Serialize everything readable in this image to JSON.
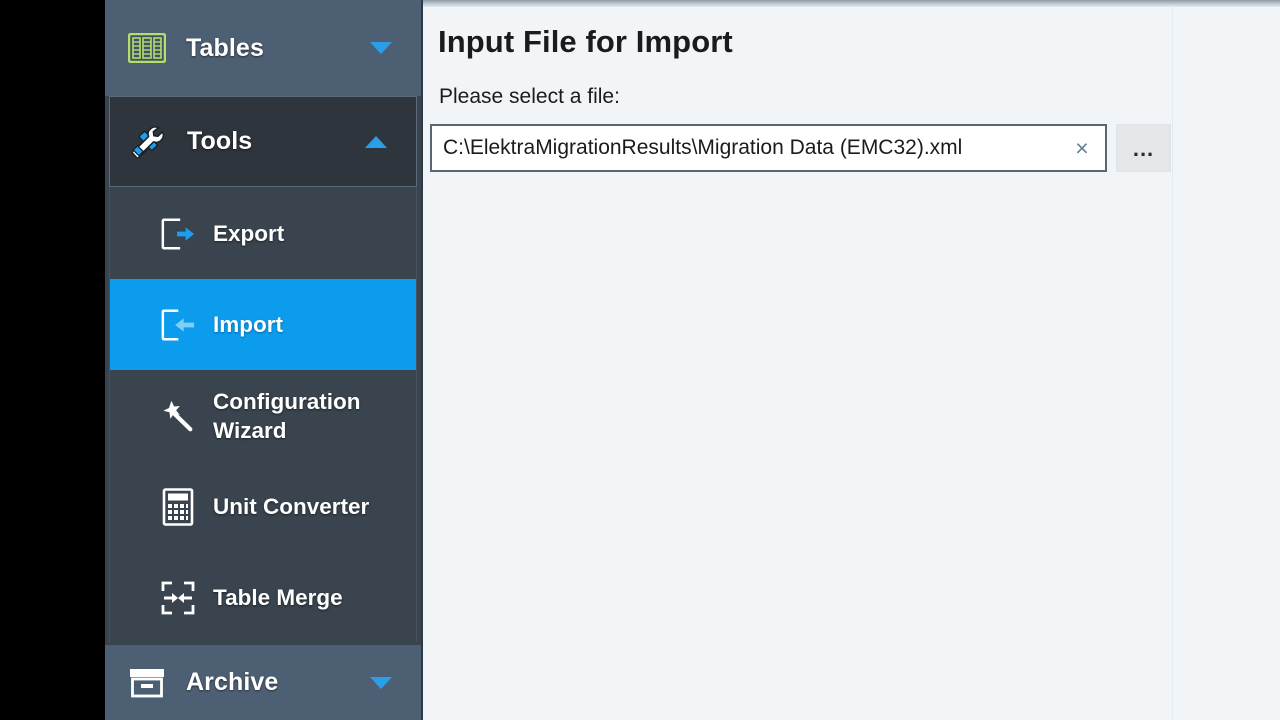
{
  "sidebar": {
    "groups": [
      {
        "label": "Tables",
        "icon": "table-grid-icon",
        "chevron": "chevron-down-icon",
        "expanded": false
      },
      {
        "label": "Tools",
        "icon": "tools-icon",
        "chevron": "chevron-up-icon",
        "expanded": true
      },
      {
        "label": "Archive",
        "icon": "archive-box-icon",
        "chevron": "chevron-down-icon",
        "expanded": false
      }
    ],
    "tools_items": [
      {
        "label": "Export",
        "icon": "export-arrow-icon",
        "selected": false
      },
      {
        "label": "Import",
        "icon": "import-arrow-icon",
        "selected": true
      },
      {
        "label": "Configuration Wizard",
        "icon": "magic-wand-icon",
        "selected": false
      },
      {
        "label": "Unit Converter",
        "icon": "calculator-icon",
        "selected": false
      },
      {
        "label": "Table Merge",
        "icon": "merge-arrows-icon",
        "selected": false
      }
    ],
    "scrollbar": {
      "name": "sidebar-scrollbar"
    }
  },
  "main": {
    "title": "Input File for Import",
    "field_label": "Please select a file:",
    "file_input": {
      "value": "C:\\ElektraMigrationResults\\Migration Data (EMC32).xml",
      "placeholder": ""
    },
    "clear_button_glyph": "×",
    "browse_button_label": "..."
  },
  "colors": {
    "accent_selected": "#0b9ced",
    "sidebar_bg": "#4d6073",
    "sidebar_group_bg": "#3a444e",
    "sidebar_header_bg": "#2e353c",
    "content_bg": "#f2f5f8",
    "tables_icon_green": "#b5dd6b",
    "chevron_blue": "#2a9fe8"
  }
}
